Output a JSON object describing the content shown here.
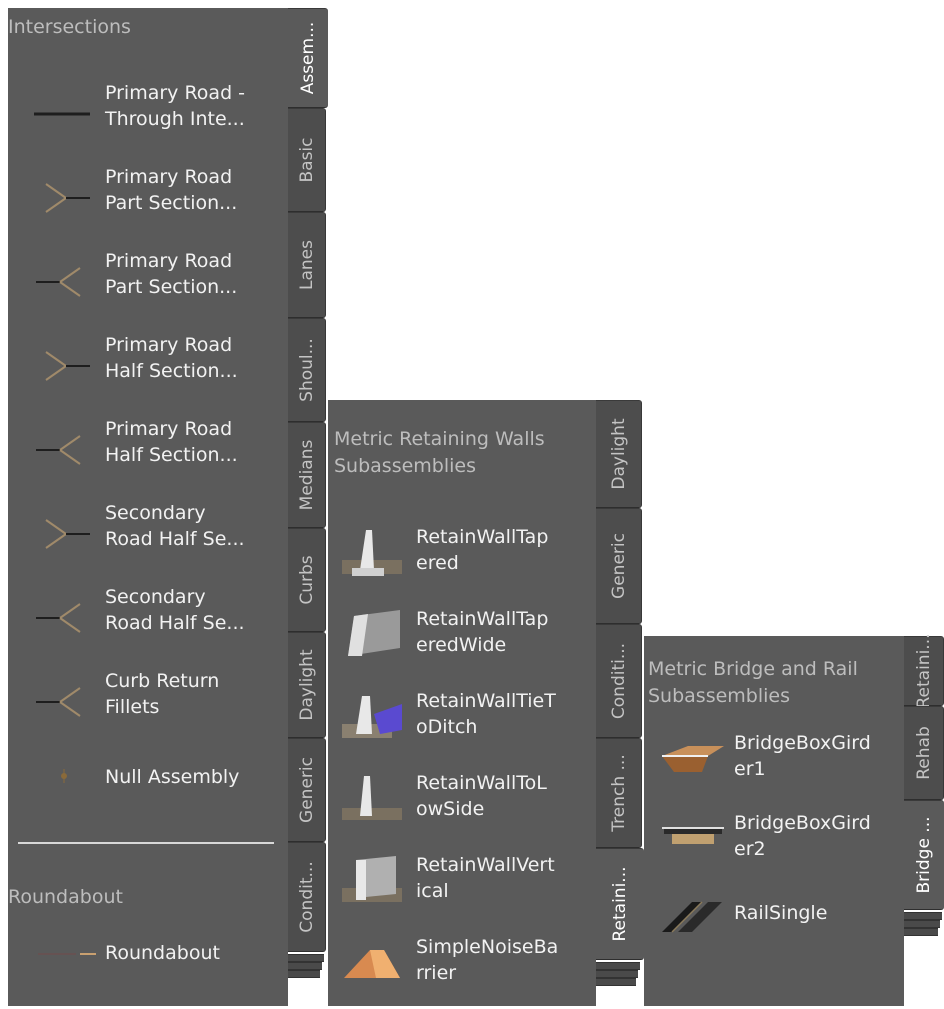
{
  "palette1": {
    "sections": [
      {
        "title": "Intersections",
        "items": [
          {
            "label": "Primary Road -\nThrough Inte...",
            "icon": "line-icon"
          },
          {
            "label": "Primary Road\nPart Section...",
            "icon": "y-junction-right-icon"
          },
          {
            "label": "Primary Road\nPart Section...",
            "icon": "y-junction-left-icon"
          },
          {
            "label": "Primary Road\nHalf Section...",
            "icon": "y-junction-right-icon"
          },
          {
            "label": "Primary Road\nHalf Section...",
            "icon": "y-junction-left-icon"
          },
          {
            "label": "Secondary\nRoad Half Se...",
            "icon": "y-junction-right-icon"
          },
          {
            "label": "Secondary\nRoad Half Se...",
            "icon": "y-junction-left-icon"
          },
          {
            "label": "Curb Return\nFillets",
            "icon": "y-junction-left-icon"
          },
          {
            "label": "Null Assembly",
            "icon": "point-icon"
          }
        ]
      },
      {
        "title": "Roundabout",
        "items": [
          {
            "label": "Roundabout",
            "icon": "roundabout-line-icon"
          }
        ]
      }
    ],
    "tabs": [
      "Assem...",
      "Basic",
      "Lanes",
      "Shoul...",
      "Medians",
      "Curbs",
      "Daylight",
      "Generic",
      "Condit..."
    ],
    "active_tab": "Assem..."
  },
  "palette2": {
    "title": "Metric Retaining Walls\nSubassemblies",
    "items": [
      {
        "label": "RetainWallTap\nered",
        "icon": "retaining-wall-tapered-icon"
      },
      {
        "label": "RetainWallTap\neredWide",
        "icon": "retaining-wall-wide-icon"
      },
      {
        "label": "RetainWallTieT\noDitch",
        "icon": "retaining-wall-ditch-icon"
      },
      {
        "label": "RetainWallToL\nowSide",
        "icon": "retaining-wall-lowside-icon"
      },
      {
        "label": "RetainWallVert\nical",
        "icon": "retaining-wall-vertical-icon"
      },
      {
        "label": "SimpleNoiseBa\nrrier",
        "icon": "noise-barrier-icon"
      }
    ],
    "tabs": [
      "Daylight",
      "Generic",
      "Conditi...",
      "Trench ...",
      "Retaini..."
    ],
    "active_tab": "Retaini..."
  },
  "palette3": {
    "title": "Metric Bridge and Rail\nSubassemblies",
    "items": [
      {
        "label": "BridgeBoxGird\ner1",
        "icon": "bridge-box-girder-icon"
      },
      {
        "label": "BridgeBoxGird\ner2",
        "icon": "bridge-box-girder-2-icon"
      },
      {
        "label": "RailSingle",
        "icon": "rail-single-icon"
      }
    ],
    "tabs": [
      "Retaini...",
      "Rehab",
      "Bridge ..."
    ],
    "active_tab": "Bridge ..."
  }
}
